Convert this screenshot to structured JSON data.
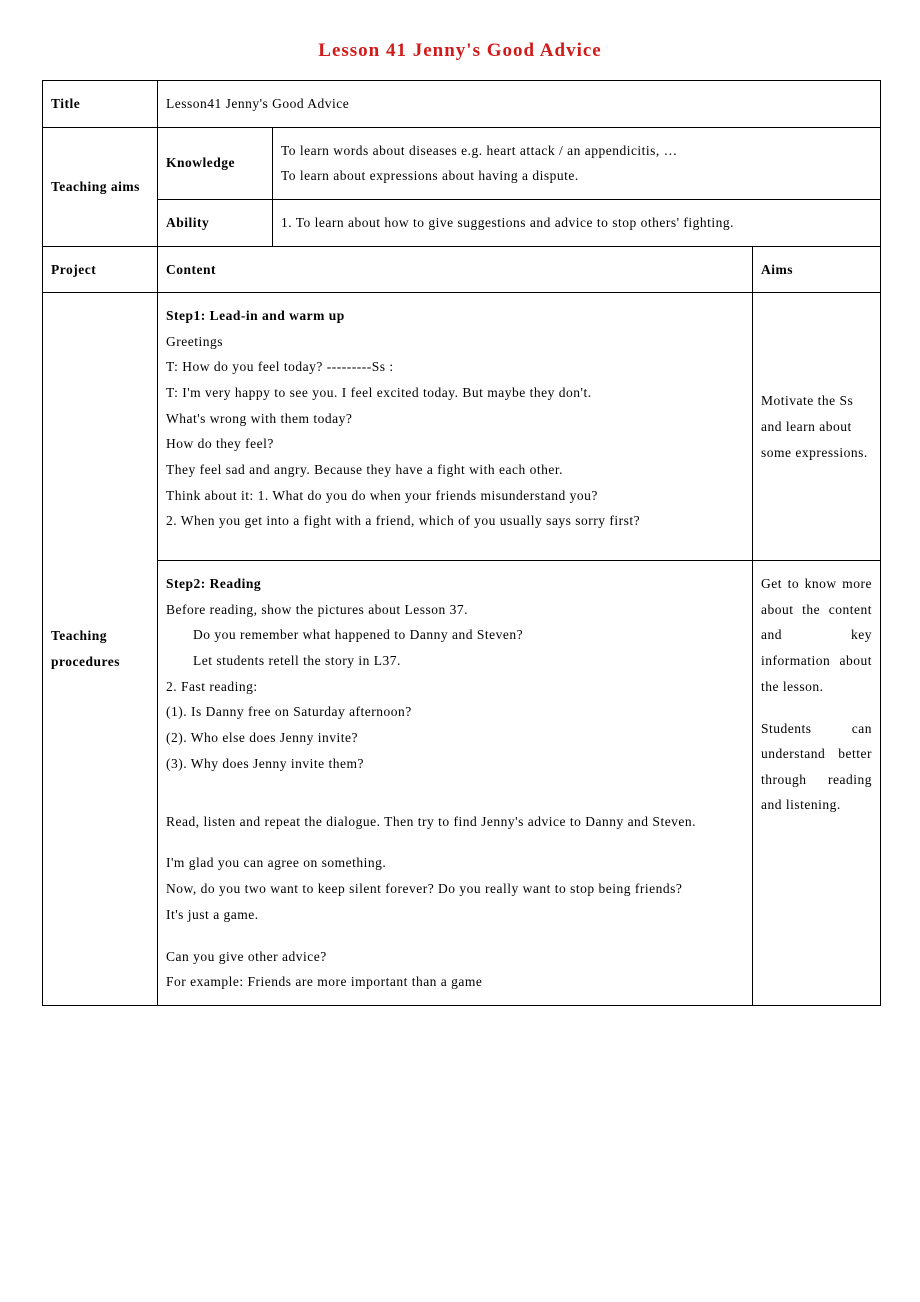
{
  "page_title": "Lesson 41 Jenny's Good Advice",
  "rows": {
    "title_label": "Title",
    "title_value": "Lesson41 Jenny's Good Advice",
    "teaching_aims_label": "Teaching aims",
    "knowledge_label": "Knowledge",
    "knowledge_value": "To learn words about diseases e.g. heart attack / an appendicitis, …\nTo learn about expressions about having a dispute.",
    "ability_label": "Ability",
    "ability_value": "1. To learn about how to give suggestions and advice to stop others' fighting.",
    "project_label": "Project",
    "content_label": "Content",
    "aims_label": "Aims",
    "procedures_label": "Teaching procedures"
  },
  "step1": {
    "heading": "Step1: Lead-in and warm up",
    "line1": "Greetings",
    "line2": "T: How do you feel today?  ---------Ss :",
    "line3": "T: I'm very happy to see you. I feel excited today. But maybe they don't.",
    "line4": "What's wrong with them today?",
    "line5": "How do they feel?",
    "line6": "They feel sad and angry. Because they have a fight with each other.",
    "line7": "Think about it:  1. What do you do when your friends misunderstand you?",
    "line8": "2. When you get into a fight with a friend, which of you usually says sorry first?",
    "aims": "Motivate the Ss and learn about some expressions."
  },
  "step2": {
    "heading": "Step2: Reading",
    "line1": "Before reading, show the pictures about Lesson 37.",
    "line2": "Do you remember what happened to Danny and Steven?",
    "line3": "Let students retell the story in L37.",
    "line4": "2. Fast reading:",
    "line5": "(1). Is Danny free on Saturday afternoon?",
    "line6": " (2). Who else does Jenny invite?",
    "line7": " (3). Why does Jenny invite them?",
    "line8": "Read, listen and repeat the dialogue. Then try to find Jenny's advice to Danny and Steven.",
    "line9": "I'm glad you can agree on something.",
    "line10": "Now, do you two want to keep silent forever? Do you really want to stop being friends?",
    "line11": "It's just a game.",
    "line12": "Can you give other advice?",
    "line13": " For example: Friends are more important than a game",
    "aims1": "Get to know more about the content and key information about the lesson.",
    "aims2": "Students can understand better through reading and listening."
  }
}
